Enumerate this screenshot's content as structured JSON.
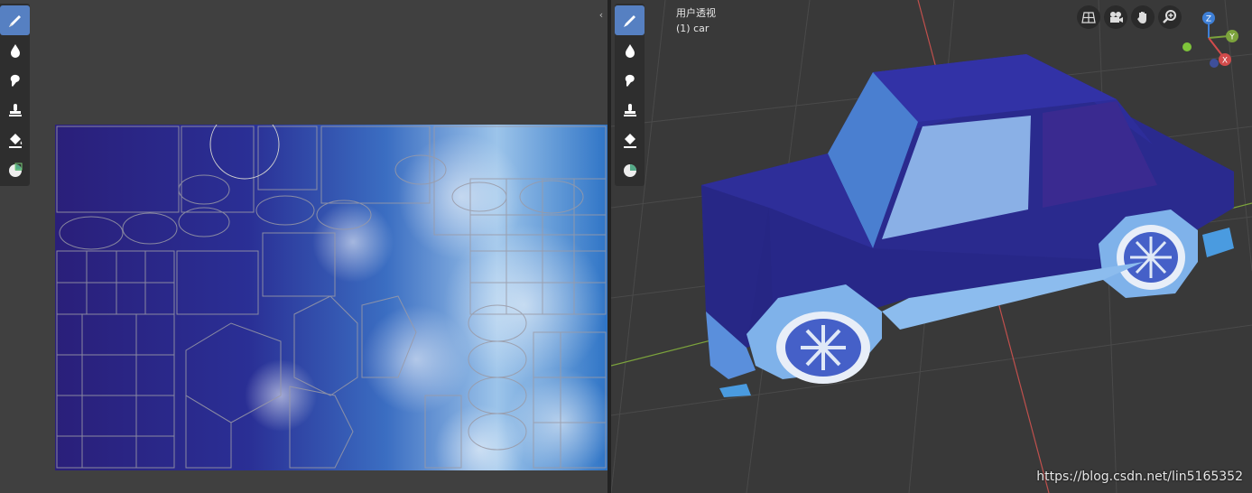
{
  "left_toolbar": {
    "tools": [
      {
        "name": "draw-brush-icon",
        "active": true
      },
      {
        "name": "soften-icon",
        "active": false
      },
      {
        "name": "smear-icon",
        "active": false
      },
      {
        "name": "clone-stamp-icon",
        "active": false
      },
      {
        "name": "fill-icon",
        "active": false
      },
      {
        "name": "mask-icon",
        "active": false
      }
    ]
  },
  "viewport": {
    "header": "用户透视",
    "object": "(1) car",
    "nav_buttons": [
      "grid-view-icon",
      "camera-icon",
      "hand-pan-icon",
      "zoom-icon"
    ],
    "gizmo": {
      "z": "Z",
      "y": "Y",
      "x": "X"
    }
  },
  "colors": {
    "active_tool": "#5680c2",
    "car_body": "#2a2a8e",
    "grid_red": "#c0504d",
    "grid_green": "#7ca33c"
  },
  "watermark": "https://blog.csdn.net/lin5165352"
}
